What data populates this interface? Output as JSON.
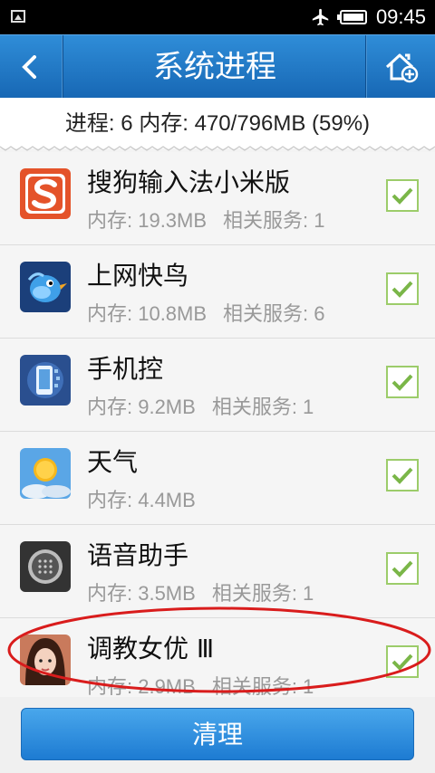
{
  "status_bar": {
    "time": "09:45",
    "icons": [
      "image-icon",
      "airplane-icon",
      "battery-icon"
    ]
  },
  "header": {
    "title": "系统进程",
    "back_icon": "chevron-left-icon",
    "home_icon": "home-add-icon"
  },
  "summary": {
    "text": "进程: 6    内存: 470/796MB (59%)"
  },
  "processes": [
    {
      "name": "搜狗输入法小米版",
      "memory": "内存: 19.3MB",
      "services": "相关服务: 1",
      "checked": true,
      "icon": "sogou-icon"
    },
    {
      "name": "上网快鸟",
      "memory": "内存: 10.8MB",
      "services": "相关服务: 6",
      "checked": true,
      "icon": "bird-icon"
    },
    {
      "name": "手机控",
      "memory": "内存: 9.2MB",
      "services": "相关服务: 1",
      "checked": true,
      "icon": "phone-control-icon"
    },
    {
      "name": "天气",
      "memory": "内存: 4.4MB",
      "services": "",
      "checked": true,
      "icon": "weather-icon"
    },
    {
      "name": "语音助手",
      "memory": "内存: 3.5MB",
      "services": "相关服务: 1",
      "checked": true,
      "icon": "voice-assistant-icon"
    },
    {
      "name": "调教女优 Ⅲ",
      "memory": "内存: 2.9MB",
      "services": "相关服务: 1",
      "checked": true,
      "icon": "girl-avatar-icon"
    }
  ],
  "footer": {
    "clean_label": "清理"
  },
  "colors": {
    "header": "#1f78c6",
    "check": "#7ab648",
    "highlight_oval": "#d91c1c"
  }
}
